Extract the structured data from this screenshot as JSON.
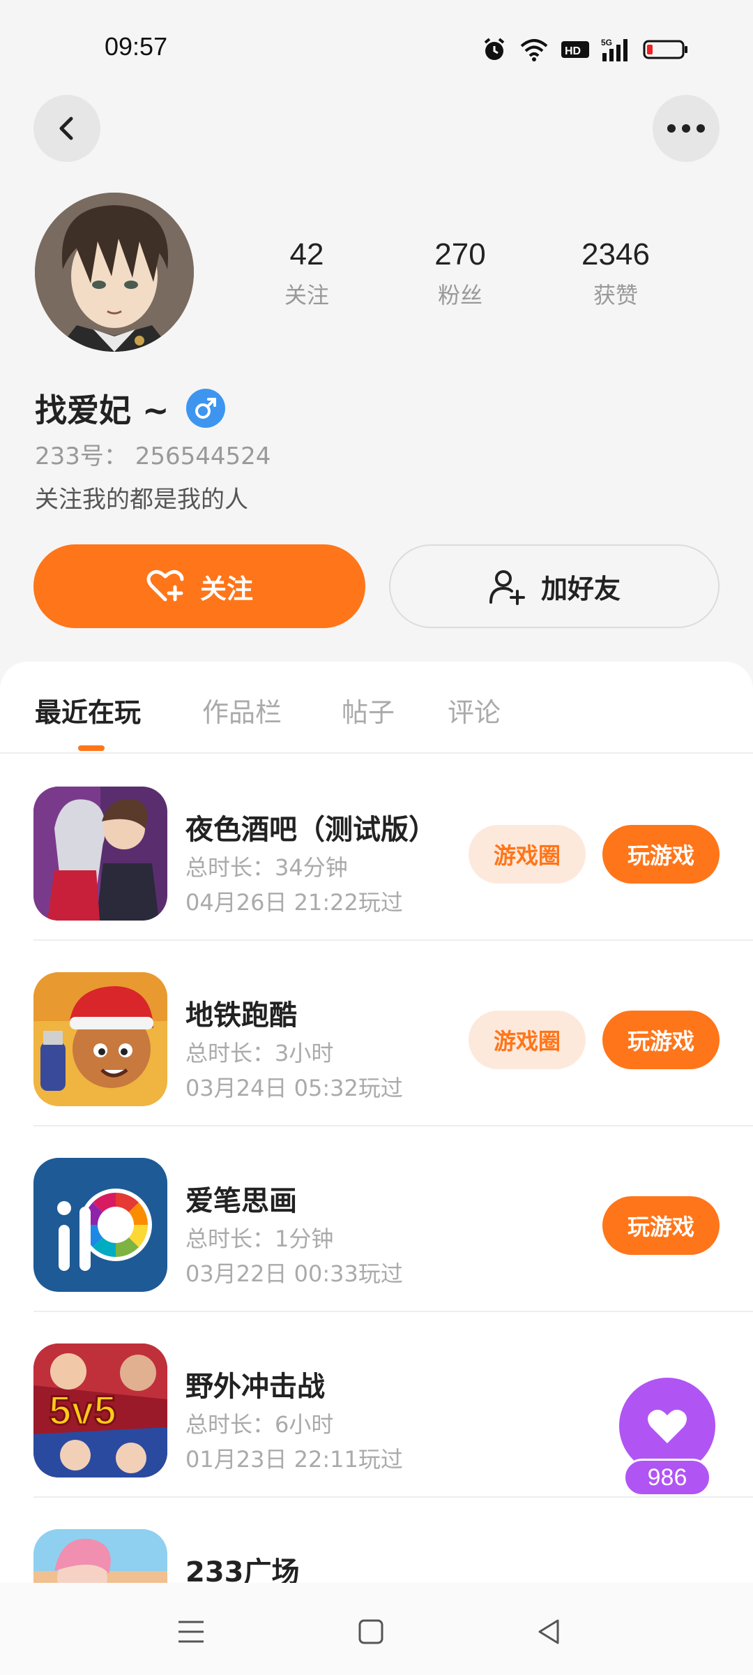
{
  "status_bar": {
    "time": "09:57"
  },
  "header": {
    "back_icon": "chevron-left-icon",
    "more_icon": "more-dots-icon"
  },
  "profile": {
    "name": "找爱妃 ~",
    "gender_icon": "male-icon",
    "uid_text": "233号： 256544524",
    "bio": "关注我的都是我的人",
    "stats": [
      {
        "value": "42",
        "label": "关注"
      },
      {
        "value": "270",
        "label": "粉丝"
      },
      {
        "value": "2346",
        "label": "获赞"
      }
    ],
    "follow_label": "关注",
    "add_friend_label": "加好友"
  },
  "tabs": [
    {
      "label": "最近在玩",
      "active": true
    },
    {
      "label": "作品栏",
      "active": false
    },
    {
      "label": "帖子",
      "active": false
    },
    {
      "label": "评论",
      "active": false
    }
  ],
  "games": [
    {
      "title": "夜色酒吧（测试版）",
      "duration": "总时长：34分钟",
      "last_played": "04月26日 21:22玩过",
      "circle_label": "游戏圈",
      "play_label": "玩游戏"
    },
    {
      "title": "地铁跑酷",
      "duration": "总时长：3小时",
      "last_played": "03月24日 05:32玩过",
      "circle_label": "游戏圈",
      "play_label": "玩游戏"
    },
    {
      "title": "爱笔思画",
      "duration": "总时长：1分钟",
      "last_played": "03月22日 00:33玩过",
      "circle_label": "",
      "play_label": "玩游戏"
    },
    {
      "title": "野外冲击战",
      "duration": "总时长：6小时",
      "last_played": "01月23日 22:11玩过",
      "circle_label": "",
      "play_label": ""
    },
    {
      "title": "233广场",
      "duration": "",
      "last_played": "",
      "circle_label": "",
      "play_label": ""
    }
  ],
  "float_like": {
    "count": "986"
  },
  "colors": {
    "accent": "#ff7519",
    "accent_soft": "#fde9dc",
    "like_purple": "#b055f4",
    "gender_blue": "#3d95f0"
  }
}
